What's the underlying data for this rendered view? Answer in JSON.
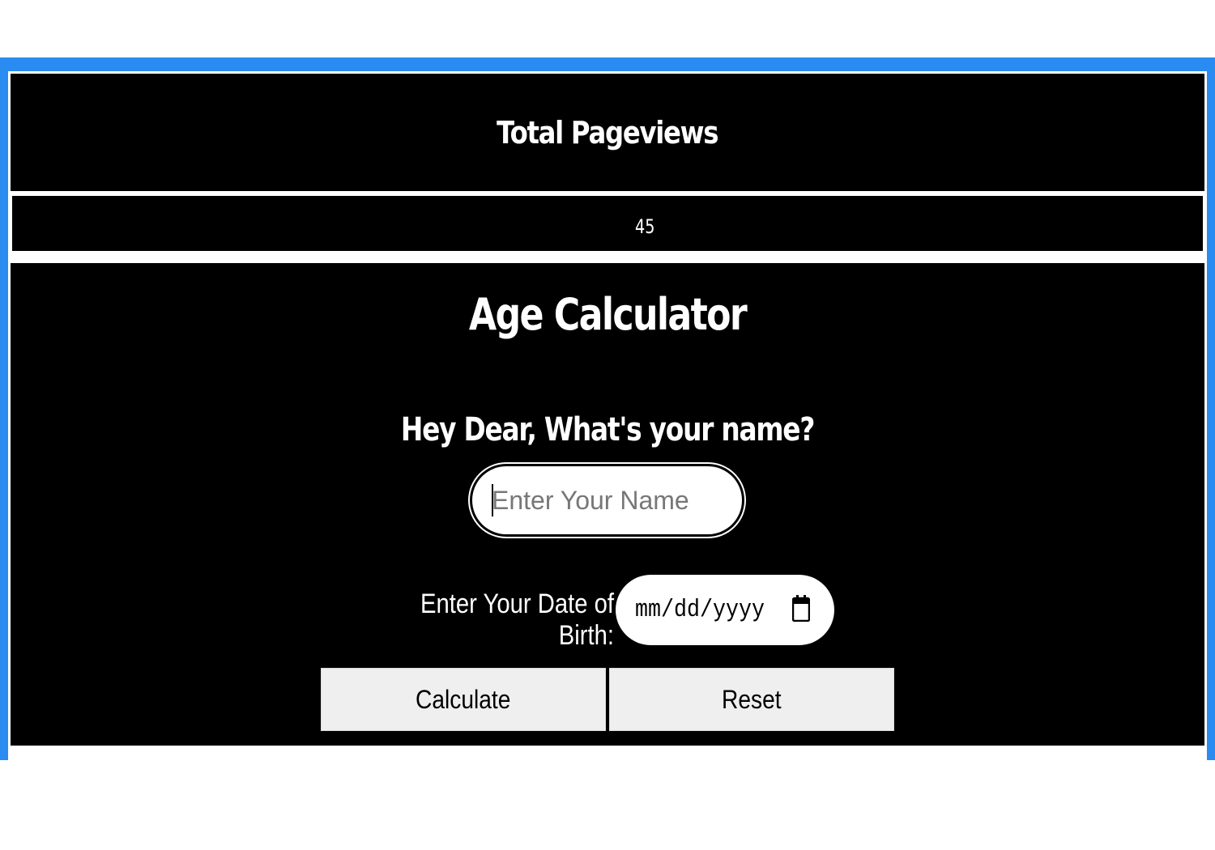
{
  "pageviews": {
    "title": "Total Pageviews",
    "count": "45"
  },
  "calculator": {
    "title": "Age Calculator",
    "name_question": "Hey Dear, What's your name?",
    "name_input": {
      "placeholder": "Enter Your Name",
      "value": ""
    },
    "dob_label": "Enter Your Date of Birth:",
    "dob_input": {
      "placeholder": "mm/dd/yyyy",
      "icon": "calendar-icon"
    },
    "buttons": {
      "calculate": "Calculate",
      "reset": "Reset"
    }
  },
  "colors": {
    "frame_accent": "#2a8cf0",
    "panel_background": "#000000",
    "button_background": "#efefef"
  }
}
